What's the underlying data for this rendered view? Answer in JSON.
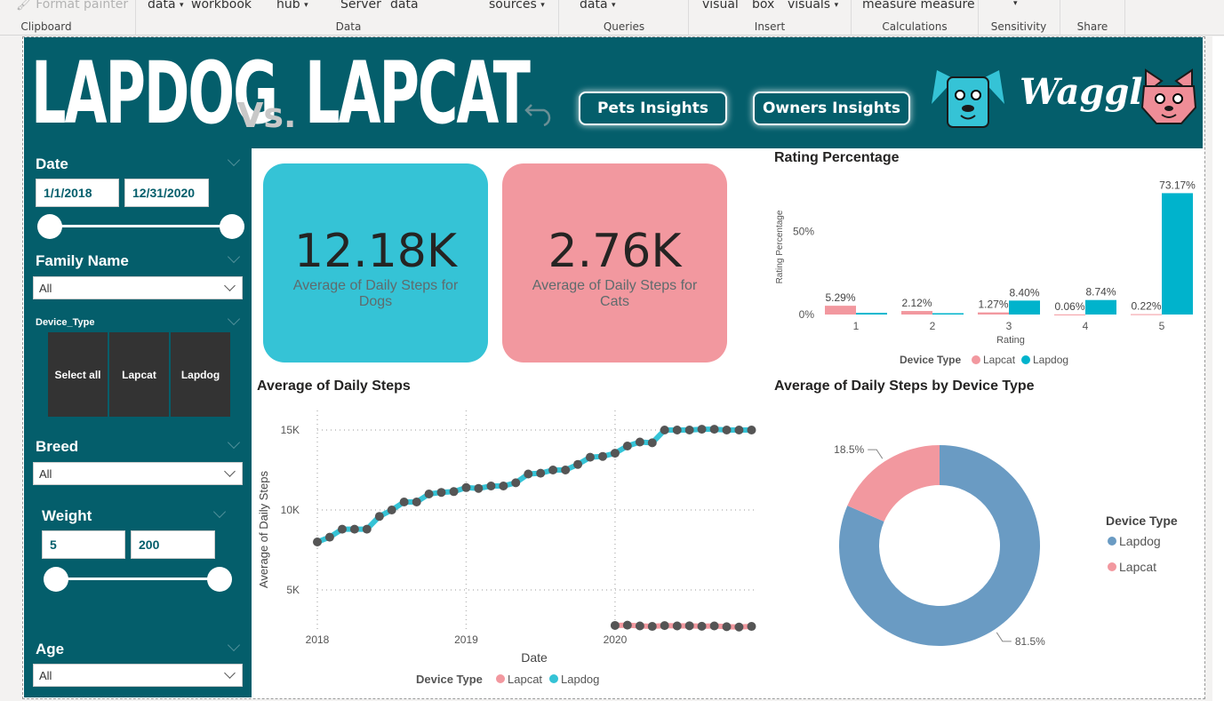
{
  "ribbon": {
    "format_painter": "Format painter",
    "top_items": [
      "data",
      "workbook",
      "hub",
      "Server",
      "data",
      "sources",
      "data",
      "visual",
      "box",
      "visuals",
      "measure measure"
    ],
    "groups": [
      "Clipboard",
      "Data",
      "Queries",
      "Insert",
      "Calculations",
      "Sensitivity",
      "Share"
    ]
  },
  "header": {
    "logo_left": "LAPDOG",
    "logo_vs": "Vs.",
    "logo_right": "LAPCAT",
    "nav_buttons": [
      "Pets Insights",
      "Owners Insights"
    ],
    "brand": "Waggle",
    "colors": {
      "teal_bg": "#045e6b",
      "dog": "#35c3d6",
      "cat": "#ef8d97"
    }
  },
  "filters": {
    "date": {
      "label": "Date",
      "start": "1/1/2018",
      "end": "12/31/2020",
      "range": [
        0,
        1
      ]
    },
    "family_name": {
      "label": "Family Name",
      "value": "All"
    },
    "device_type": {
      "label": "Device_Type",
      "options": [
        "Select all",
        "Lapcat",
        "Lapdog"
      ]
    },
    "breed": {
      "label": "Breed",
      "value": "All"
    },
    "weight": {
      "label": "Weight",
      "min": "5",
      "max": "200",
      "range": [
        0,
        1
      ]
    },
    "age": {
      "label": "Age",
      "value": "All"
    }
  },
  "kpis": [
    {
      "value": "12.18K",
      "label": "Average of Daily Steps for Dogs",
      "color": "#35c3d6"
    },
    {
      "value": "2.76K",
      "label": "Average of Daily Steps for Cats",
      "color": "#f2989f"
    }
  ],
  "chart_data": [
    {
      "type": "bar",
      "title": "Rating Percentage",
      "xlabel": "Rating",
      "ylabel": "Rating Percentage",
      "categories": [
        "1",
        "2",
        "3",
        "4",
        "5"
      ],
      "yticks": [
        "0%",
        "50%"
      ],
      "ylim": [
        0,
        75
      ],
      "series": [
        {
          "name": "Lapcat",
          "color": "#f2989f",
          "values": [
            5.29,
            2.12,
            1.27,
            0.06,
            0.22
          ],
          "labels": [
            "5.29%",
            "2.12%",
            "1.27%",
            "0.06%",
            "0.22%"
          ]
        },
        {
          "name": "Lapdog",
          "color": "#00b3cc",
          "values": [
            1.0,
            0.8,
            8.4,
            8.74,
            73.17
          ],
          "labels": [
            "",
            "",
            "8.40%",
            "8.74%",
            "73.17%"
          ]
        }
      ],
      "legend_title": "Device Type",
      "legend": "bottom"
    },
    {
      "type": "line",
      "title": "Average of Daily Steps",
      "xlabel": "Date",
      "ylabel": "Average of Daily Steps",
      "xticks": [
        "2018",
        "2019",
        "2020"
      ],
      "yticks": [
        "5K",
        "10K",
        "15K"
      ],
      "ylim": [
        2000,
        16000
      ],
      "grid": true,
      "legend_title": "Device Type",
      "legend": "bottom",
      "series": [
        {
          "name": "Lapdog",
          "color": "#35c3d6",
          "x": [
            2018.0,
            2018.083,
            2018.167,
            2018.25,
            2018.333,
            2018.417,
            2018.5,
            2018.583,
            2018.667,
            2018.75,
            2018.833,
            2018.917,
            2019.0,
            2019.083,
            2019.167,
            2019.25,
            2019.333,
            2019.417,
            2019.5,
            2019.583,
            2019.667,
            2019.75,
            2019.833,
            2019.917,
            2020.0,
            2020.083,
            2020.167,
            2020.25,
            2020.333,
            2020.417,
            2020.5,
            2020.583,
            2020.667,
            2020.75,
            2020.833,
            2020.917
          ],
          "values": [
            8000,
            8300,
            8800,
            8800,
            8800,
            9600,
            10000,
            10500,
            10500,
            11000,
            11100,
            11150,
            11400,
            11350,
            11500,
            11500,
            11700,
            12250,
            12300,
            12500,
            12500,
            12850,
            13300,
            13350,
            13550,
            14000,
            14250,
            14200,
            15000,
            15000,
            15000,
            15050,
            15050,
            15000,
            15000,
            15000
          ]
        },
        {
          "name": "Lapcat",
          "color": "#f2989f",
          "x": [
            2020.0,
            2020.083,
            2020.167,
            2020.25,
            2020.333,
            2020.417,
            2020.5,
            2020.583,
            2020.667,
            2020.75,
            2020.833,
            2020.917
          ],
          "values": [
            2780,
            2800,
            2750,
            2720,
            2770,
            2750,
            2760,
            2730,
            2750,
            2700,
            2680,
            2720
          ]
        }
      ]
    },
    {
      "type": "pie",
      "title": "Average of Daily Steps by Device Type",
      "legend_title": "Device Type",
      "legend": "right",
      "slices": [
        {
          "name": "Lapdog",
          "value": 81.5,
          "label": "81.5%",
          "color": "#6a9bc3"
        },
        {
          "name": "Lapcat",
          "value": 18.5,
          "label": "18.5%",
          "color": "#f2989f"
        }
      ]
    }
  ]
}
